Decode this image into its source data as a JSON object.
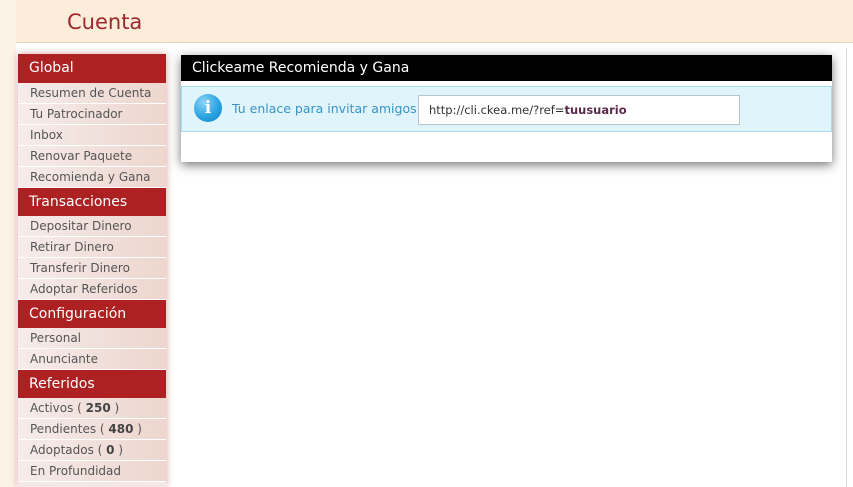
{
  "header": {
    "title": "Cuenta"
  },
  "sidebar": {
    "sections": [
      {
        "title": "Global",
        "items": [
          {
            "label": "Resumen de Cuenta"
          },
          {
            "label": "Tu Patrocinador"
          },
          {
            "label": "Inbox"
          },
          {
            "label": "Renovar Paquete"
          },
          {
            "label": "Recomienda y Gana"
          }
        ]
      },
      {
        "title": "Transacciones",
        "items": [
          {
            "label": "Depositar Dinero"
          },
          {
            "label": "Retirar Dinero"
          },
          {
            "label": "Transferir Dinero"
          },
          {
            "label": "Adoptar Referidos"
          }
        ]
      },
      {
        "title": "Configuración",
        "items": [
          {
            "label": "Personal"
          },
          {
            "label": "Anunciante"
          }
        ]
      },
      {
        "title": "Referidos",
        "items": [
          {
            "label": "Activos",
            "count": "250"
          },
          {
            "label": "Pendientes",
            "count": "480"
          },
          {
            "label": "Adoptados",
            "count": "0"
          },
          {
            "label": "En Profundidad"
          }
        ]
      }
    ]
  },
  "panel": {
    "title": "Clickeame Recomienda y Gana",
    "info": {
      "icon": "info-icon",
      "label": "Tu enlace para invitar amigos:",
      "link_prefix": "http://cli.ckea.me/?ref=",
      "link_user": "tuusuario"
    }
  },
  "colors": {
    "brand_red": "#ad2122",
    "header_bg": "#fbedd9",
    "info_bg": "#dff4fb",
    "info_text": "#3a93c2"
  }
}
